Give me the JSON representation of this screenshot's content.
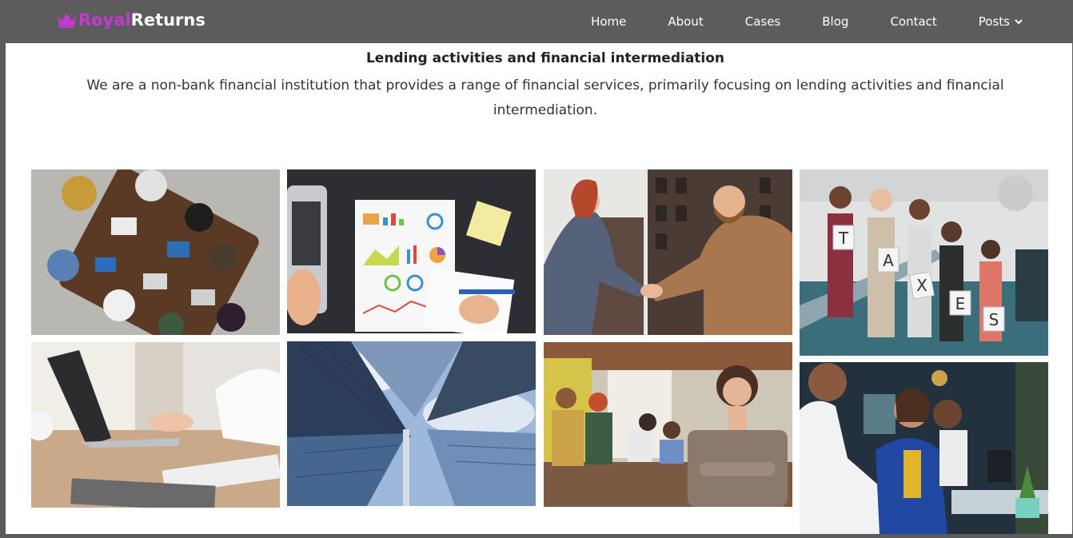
{
  "header": {
    "brand_part1": "Royal",
    "brand_part2": "Returns",
    "brand_color": "#c33ad2",
    "background": "#5c5c5c",
    "nav": [
      {
        "label": "Home"
      },
      {
        "label": "About"
      },
      {
        "label": "Cases"
      },
      {
        "label": "Blog"
      },
      {
        "label": "Contact"
      },
      {
        "label": "Posts"
      }
    ]
  },
  "main": {
    "section_title": "Lending activities and financial intermediation",
    "section_description": "We are a non-bank financial institution that provides a range of financial services, primarily focusing on lending activities and financial intermediation.",
    "gallery": [
      {
        "subject": "team-meeting-overhead"
      },
      {
        "subject": "financial-charts-desk"
      },
      {
        "subject": "business-handshake"
      },
      {
        "subject": "taxes-letters-group"
      },
      {
        "subject": "laptop-typing"
      },
      {
        "subject": "skyscrapers-view"
      },
      {
        "subject": "office-team-woman"
      },
      {
        "subject": "smiling-office-workers"
      }
    ],
    "tax_letters": [
      "T",
      "A",
      "X",
      "E",
      "S"
    ]
  }
}
